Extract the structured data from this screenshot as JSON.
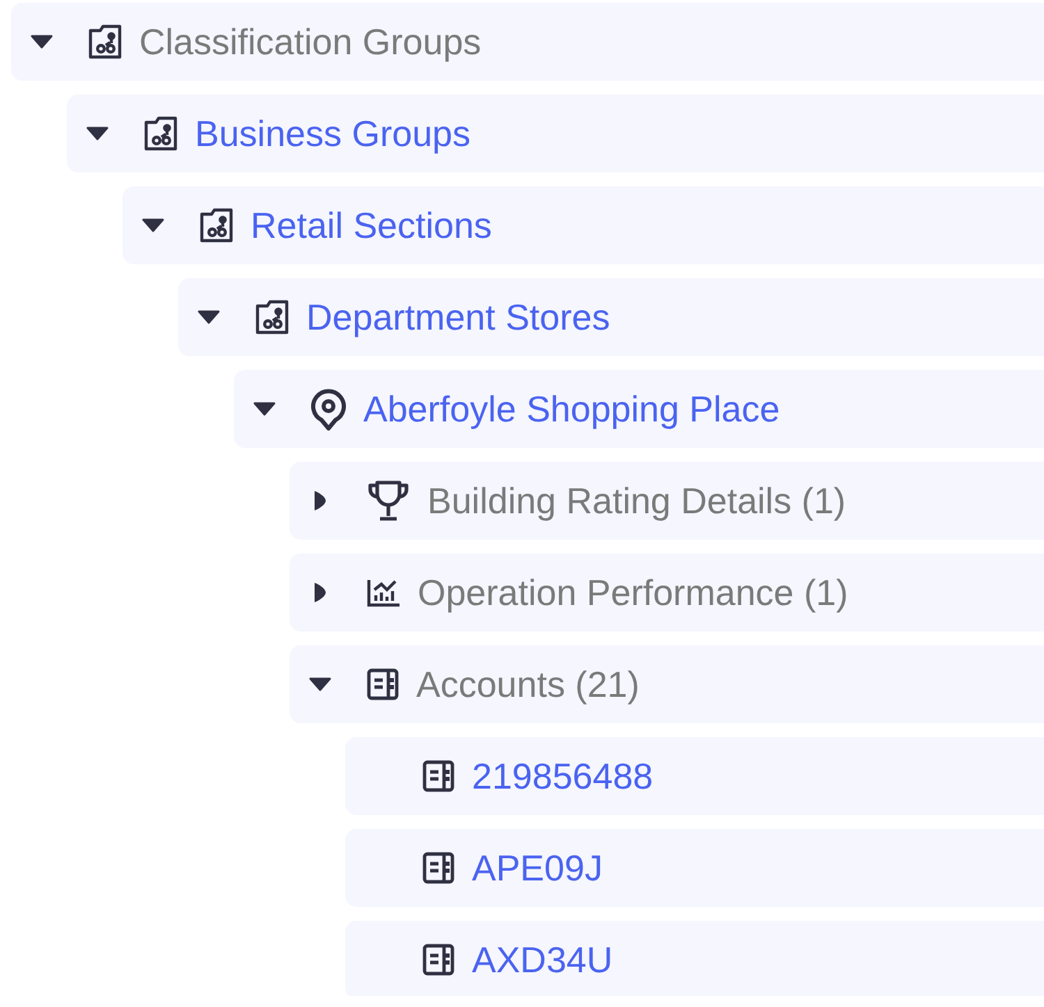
{
  "tree": [
    {
      "label": "Classification Groups",
      "kind": "group",
      "link": false,
      "expanded": true,
      "children": [
        {
          "label": "Business Groups",
          "kind": "group",
          "link": true,
          "expanded": true,
          "children": [
            {
              "label": "Retail Sections",
              "kind": "group",
              "link": true,
              "expanded": true,
              "children": [
                {
                  "label": "Department Stores",
                  "kind": "group",
                  "link": true,
                  "expanded": true,
                  "children": [
                    {
                      "label": "Aberfoyle Shopping Place",
                      "kind": "site",
                      "link": true,
                      "expanded": true,
                      "children": [
                        {
                          "label": "Building Rating Details (1)",
                          "kind": "rating",
                          "link": false,
                          "expanded": false
                        },
                        {
                          "label": "Operation Performance (1)",
                          "kind": "performance",
                          "link": false,
                          "expanded": false
                        },
                        {
                          "label": "Accounts (21)",
                          "kind": "account",
                          "link": false,
                          "expanded": true,
                          "children": [
                            {
                              "label": "219856488",
                              "kind": "account",
                              "link": true
                            },
                            {
                              "label": "APE09J",
                              "kind": "account",
                              "link": true
                            },
                            {
                              "label": "AXD34U",
                              "kind": "account",
                              "link": true
                            }
                          ]
                        }
                      ]
                    }
                  ]
                }
              ]
            }
          ]
        }
      ]
    }
  ]
}
